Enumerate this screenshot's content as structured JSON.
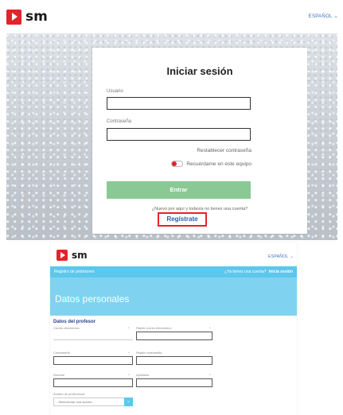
{
  "header": {
    "logo_text": "sm",
    "language": "ESPAÑOL"
  },
  "login": {
    "title": "Iniciar sesión",
    "username_label": "Usuario",
    "password_label": "Contraseña",
    "reset_link": "Restablecer contraseña",
    "remember_label": "Recuérdame en este equipo",
    "enter_button": "Entrar",
    "new_account_text": "¿Nuevo por aquí y todavía no tienes una cuenta?",
    "register_button": "Regístrate"
  },
  "registration": {
    "logo_text": "sm",
    "language": "ESPAÑOL",
    "nav_left": "Registro de profesores",
    "nav_right_question": "¿Ya tienes una cuenta?",
    "nav_right_link": "Inicia sesión",
    "banner_title": "Datos personales",
    "section_title": "Datos del profesor",
    "fields": {
      "email": "Correo electrónico",
      "email_repeat": "Repite correo electrónico",
      "password": "Contraseña",
      "password_repeat": "Repite contraseña",
      "name": "Nombre",
      "surname": "Apellidos",
      "profile": "Ámbito de preferencia"
    },
    "select_placeholder": "- Seleccionar una opción -"
  },
  "colors": {
    "brand_red": "#e2242b",
    "enter_green": "#8ac995",
    "nav_blue": "#5dc7ec",
    "link_blue": "#2a5db0"
  }
}
